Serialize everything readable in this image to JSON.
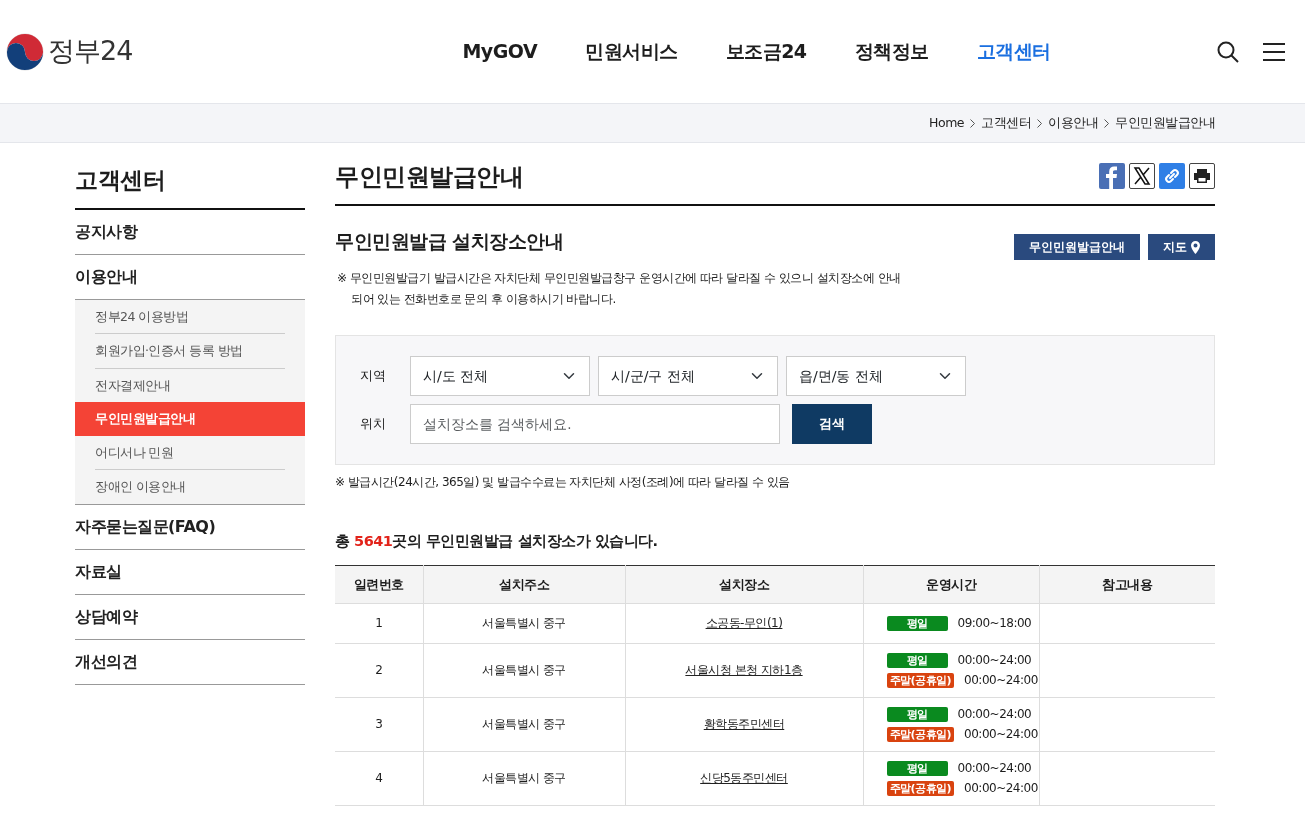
{
  "header": {
    "logo_text": "정부24",
    "nav": [
      {
        "label": "MyGOV",
        "selected": false
      },
      {
        "label": "민원서비스",
        "selected": false
      },
      {
        "label": "보조금24",
        "selected": false
      },
      {
        "label": "정책정보",
        "selected": false
      },
      {
        "label": "고객센터",
        "selected": true
      }
    ]
  },
  "breadcrumb": [
    "Home",
    "고객센터",
    "이용안내",
    "무인민원발급안내"
  ],
  "sidebar": {
    "title": "고객센터",
    "items": [
      {
        "label": "공지사항"
      },
      {
        "label": "이용안내",
        "children": [
          {
            "label": "정부24 이용방법",
            "selected": false
          },
          {
            "label": "회원가입·인증서 등록 방법",
            "selected": false
          },
          {
            "label": "전자결제안내",
            "selected": false
          },
          {
            "label": "무인민원발급안내",
            "selected": true
          },
          {
            "label": "어디서나 민원",
            "selected": false
          },
          {
            "label": "장애인 이용안내",
            "selected": false
          }
        ]
      },
      {
        "label": "자주묻는질문(FAQ)"
      },
      {
        "label": "자료실"
      },
      {
        "label": "상담예약"
      },
      {
        "label": "개선의견"
      }
    ]
  },
  "page_title": "무인민원발급안내",
  "section_title": "무인민원발급 설치장소안내",
  "section_buttons": [
    {
      "label": "무인민원발급안내",
      "kind": "plain"
    },
    {
      "label": "지도",
      "kind": "map"
    }
  ],
  "notice": "※ 무인민원발급기 발급시간은 자치단체 무인민원발급창구 운영시간에 따라 달라질 수 있으니 설치장소에 안내되어 있는 전화번호로 문의 후 이용하시기 바랍니다.",
  "search": {
    "region_label": "지역",
    "selects": [
      "시/도 전체",
      "시/군/구 전체",
      "읍/면/동 전체"
    ],
    "location_label": "위치",
    "placeholder": "설치장소를 검색하세요.",
    "button": "검색"
  },
  "fee_note": "※ 발급시간(24시간, 365일) 및 발급수수료는 자치단체 사정(조례)에 따라 달라질 수 있음",
  "total": "총 **5641**곳의 무인민원발급 설치장소가 있습니다.",
  "table": {
    "columns": [
      "일련번호",
      "설치주소",
      "설치장소",
      "운영시간",
      "참고내용"
    ],
    "rows": [
      {
        "no": "1",
        "address": "서울특별시 중구",
        "place": "소공동-무인(1)",
        "hours": [
          {
            "kind": "weekday",
            "label": "평일",
            "time": "09:00~18:00"
          }
        ]
      },
      {
        "no": "2",
        "address": "서울특별시 중구",
        "place": "서울시청 본청 지하1층",
        "hours": [
          {
            "kind": "weekday",
            "label": "평일",
            "time": "00:00~24:00"
          },
          {
            "kind": "weekend",
            "label": "주말(공휴일)",
            "time": "00:00~24:00"
          }
        ]
      },
      {
        "no": "3",
        "address": "서울특별시 중구",
        "place": "황학동주민센터",
        "hours": [
          {
            "kind": "weekday",
            "label": "평일",
            "time": "00:00~24:00"
          },
          {
            "kind": "weekend",
            "label": "주말(공휴일)",
            "time": "00:00~24:00"
          }
        ]
      },
      {
        "no": "4",
        "address": "서울특별시 중구",
        "place": "신당5동주민센터",
        "hours": [
          {
            "kind": "weekday",
            "label": "평일",
            "time": "00:00~24:00"
          },
          {
            "kind": "weekend",
            "label": "주말(공휴일)",
            "time": "00:00~24:00"
          }
        ]
      }
    ]
  }
}
